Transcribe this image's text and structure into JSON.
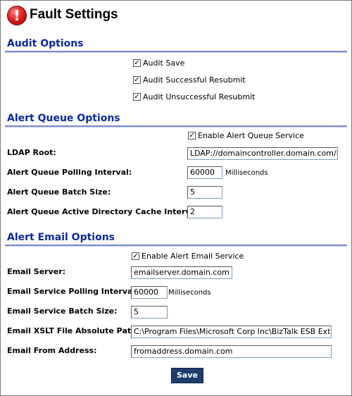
{
  "header": {
    "title": "Fault Settings",
    "icon": "error-exclamation-icon",
    "icon_glyph": "!"
  },
  "audit": {
    "title": "Audit Options",
    "options": [
      {
        "label": "Audit Save",
        "checked": true
      },
      {
        "label": "Audit Successful Resubmit",
        "checked": true
      },
      {
        "label": "Audit Unsuccessful Resubmit",
        "checked": true
      }
    ]
  },
  "alert_queue": {
    "title": "Alert Queue Options",
    "enable": {
      "label": "Enable Alert Queue Service",
      "checked": true
    },
    "ldap_root": {
      "label": "LDAP Root:",
      "value": "LDAP://domaincontroller.domain.com/DC=domain,DC=com"
    },
    "polling_interval": {
      "label": "Alert Queue Polling Interval:",
      "value": "60000",
      "unit": "Milliseconds"
    },
    "batch_size": {
      "label": "Alert Queue Batch Size:",
      "value": "5"
    },
    "cache_interval": {
      "label": "Alert Queue Active Directory Cache Interval:",
      "value": "2"
    }
  },
  "alert_email": {
    "title": "Alert Email Options",
    "enable": {
      "label": "Enable Alert Email Service",
      "checked": true
    },
    "server": {
      "label": "Email Server:",
      "value": "emailserver.domain.com"
    },
    "polling_interval": {
      "label": "Email Service Polling Interval:",
      "value": "60000",
      "unit": "Milliseconds"
    },
    "batch_size": {
      "label": "Email Service Batch Size:",
      "value": "5"
    },
    "xslt_path": {
      "label": "Email XSLT File Absolute Path:",
      "value": "C:\\Program Files\\Microsoft Corp Inc\\BizTalk ESB Extensions\\Email.xslt"
    },
    "from_address": {
      "label": "Email From Address:",
      "value": "fromaddress.domain.com"
    }
  },
  "actions": {
    "save_label": "Save"
  },
  "colors": {
    "section_title": "#0a2aa0",
    "section_rule": "#7b8cd0",
    "save_button": "#1e3d6b",
    "error_icon": "#e02222"
  }
}
